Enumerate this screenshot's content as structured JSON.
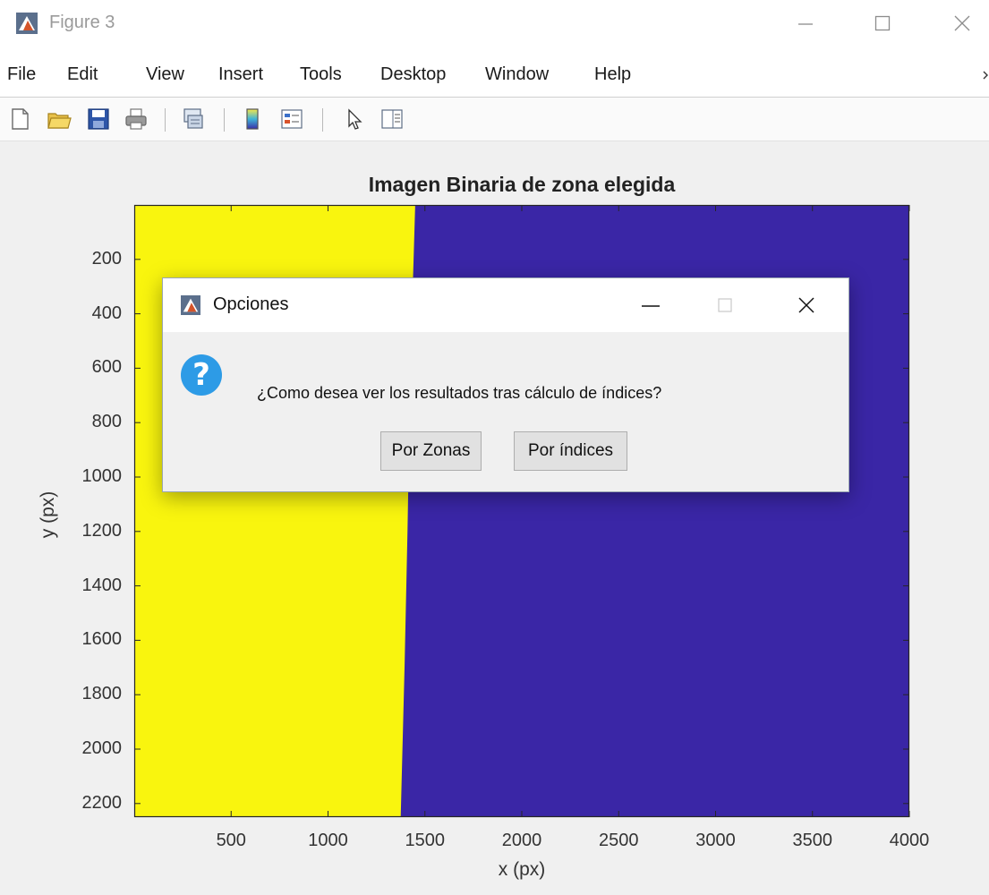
{
  "window": {
    "title": "Figure 3",
    "controls": [
      "minimize-icon",
      "maximize-icon",
      "close-icon"
    ]
  },
  "menubar": {
    "items": [
      {
        "label": "File"
      },
      {
        "label": "Edit"
      },
      {
        "label": "View"
      },
      {
        "label": "Insert"
      },
      {
        "label": "Tools"
      },
      {
        "label": "Desktop"
      },
      {
        "label": "Window"
      },
      {
        "label": "Help"
      }
    ]
  },
  "toolbar": {
    "buttons": [
      "new-figure-icon",
      "open-file-icon",
      "save-icon",
      "print-icon",
      "link-plot-icon",
      "colorbar-icon",
      "legend-icon",
      "select-arrow-icon",
      "property-inspector-icon"
    ]
  },
  "chart_data": {
    "type": "heatmap",
    "title": "Imagen Binaria de zona elegida",
    "xlabel": "x (px)",
    "ylabel": "y (px)",
    "xlim": [
      0,
      4000
    ],
    "ylim": [
      0,
      2250
    ],
    "y_reversed": true,
    "xticks": [
      500,
      1000,
      1500,
      2000,
      2500,
      3000,
      3500,
      4000
    ],
    "yticks": [
      200,
      400,
      600,
      800,
      1000,
      1200,
      1400,
      1600,
      1800,
      2000,
      2200
    ],
    "colors": {
      "value_1": "#f9f50e",
      "value_0": "#3a26a6"
    },
    "boundary": {
      "description_values": "x position of the yellow/blue boundary at given y",
      "points": [
        {
          "y": 0,
          "x": 1450
        },
        {
          "y": 600,
          "x": 1425
        },
        {
          "y": 1200,
          "x": 1410
        },
        {
          "y": 1700,
          "x": 1395
        },
        {
          "y": 2250,
          "x": 1375
        }
      ]
    }
  },
  "dialog": {
    "title": "Opciones",
    "message": "¿Como desea ver los resultados tras cálculo de índices?",
    "icon": "question-icon",
    "buttons": [
      {
        "label": "Por Zonas"
      },
      {
        "label": "Por índices"
      }
    ]
  }
}
